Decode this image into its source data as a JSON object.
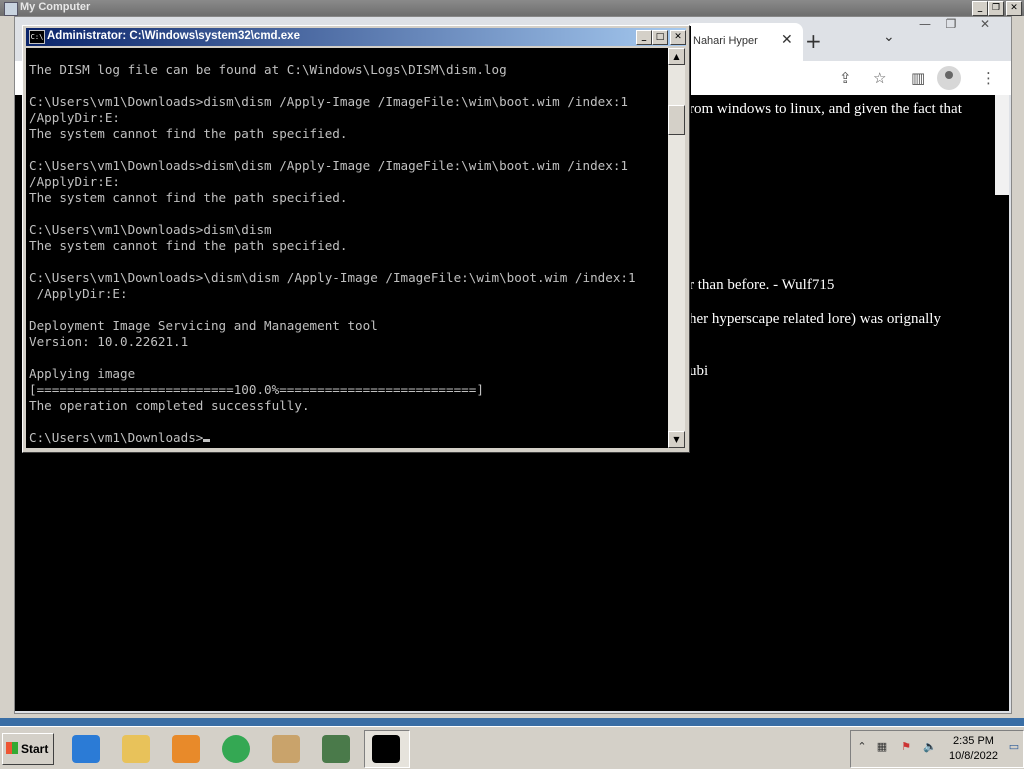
{
  "vm_window": {
    "title": "My Computer"
  },
  "browser": {
    "tab_title": "Nahari Hyper",
    "tab_close": "✕",
    "new_tab": "+",
    "tab_dropdown": "⌄",
    "page_lines": [
      "rom windows to linux, and given the fact that",
      "r than before. - Wulf715",
      "her hyperscape related lore) was orignally",
      "ubi"
    ]
  },
  "cmd": {
    "title": "Administrator: C:\\Windows\\system32\\cmd.exe",
    "icon_label": "C:\\",
    "lines": [
      "",
      "The DISM log file can be found at C:\\Windows\\Logs\\DISM\\dism.log",
      "",
      "C:\\Users\\vm1\\Downloads>dism\\dism /Apply-Image /ImageFile:\\wim\\boot.wim /index:1",
      "/ApplyDir:E:",
      "The system cannot find the path specified.",
      "",
      "C:\\Users\\vm1\\Downloads>dism\\dism /Apply-Image /ImageFile:\\wim\\boot.wim /index:1",
      "/ApplyDir:E:",
      "The system cannot find the path specified.",
      "",
      "C:\\Users\\vm1\\Downloads>dism\\dism",
      "The system cannot find the path specified.",
      "",
      "C:\\Users\\vm1\\Downloads>\\dism\\dism /Apply-Image /ImageFile:\\wim\\boot.wim /index:1",
      " /ApplyDir:E:",
      "",
      "Deployment Image Servicing and Management tool",
      "Version: 10.0.22621.1",
      "",
      "Applying image",
      "[==========================100.0%==========================]",
      "The operation completed successfully.",
      ""
    ],
    "prompt": "C:\\Users\\vm1\\Downloads>"
  },
  "taskbar": {
    "start_label": "Start",
    "clock_time": "2:35 PM",
    "clock_date": "10/8/2022",
    "apps": [
      {
        "name": "internet-explorer",
        "color": "#2b7bd6"
      },
      {
        "name": "file-explorer",
        "color": "#e8c25a"
      },
      {
        "name": "media-player",
        "color": "#e88a2a"
      },
      {
        "name": "chrome",
        "color": "#34a853"
      },
      {
        "name": "paint",
        "color": "#c9a36b"
      },
      {
        "name": "task-manager",
        "color": "#4a7a4a"
      },
      {
        "name": "command-prompt",
        "color": "#000000"
      }
    ]
  }
}
